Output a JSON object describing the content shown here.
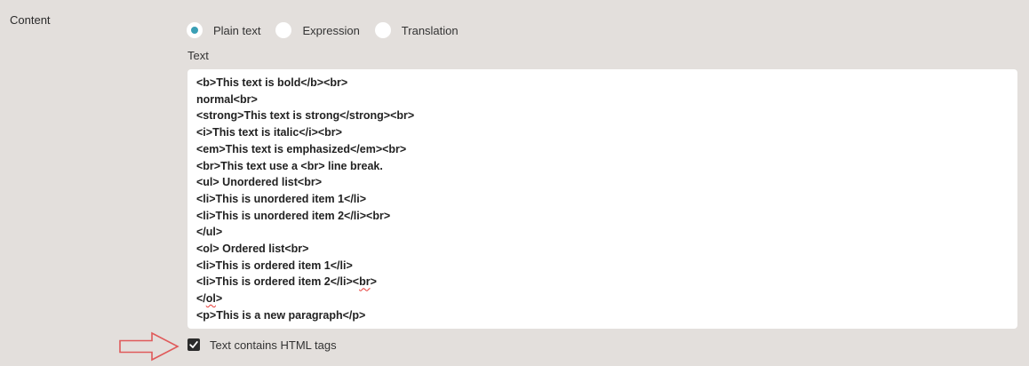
{
  "content": {
    "label": "Content"
  },
  "radio_group": {
    "options": [
      {
        "label": "Plain text",
        "selected": true
      },
      {
        "label": "Expression",
        "selected": false
      },
      {
        "label": "Translation",
        "selected": false
      }
    ]
  },
  "text_field": {
    "label": "Text",
    "lines": [
      "<b>This text is bold</b><br>",
      "normal<br>",
      "<strong>This text is strong</strong><br>",
      "<i>This text is italic</i><br>",
      "<em>This text is emphasized</em><br>",
      "<br>This text use a <br> line break.",
      "<ul> Unordered list<br>",
      "<li>This is unordered item 1</li>",
      "<li>This is unordered item 2</li><br>",
      "</ul>",
      "<ol> Ordered list<br>",
      "<li>This is ordered item 1</li>",
      "<li>This is ordered item 2</li>",
      "br",
      ">",
      "</",
      "ol",
      ">",
      "<p>This is a new paragraph</p>"
    ]
  },
  "checkbox": {
    "label": "Text contains HTML tags",
    "checked": true
  },
  "colors": {
    "background": "#e3dfdc",
    "radio_selected": "#3a9fb5",
    "spell_error": "#e53935",
    "arrow": "#e05a5a"
  },
  "icons": [
    "arrow-right-icon",
    "checkmark-icon"
  ]
}
